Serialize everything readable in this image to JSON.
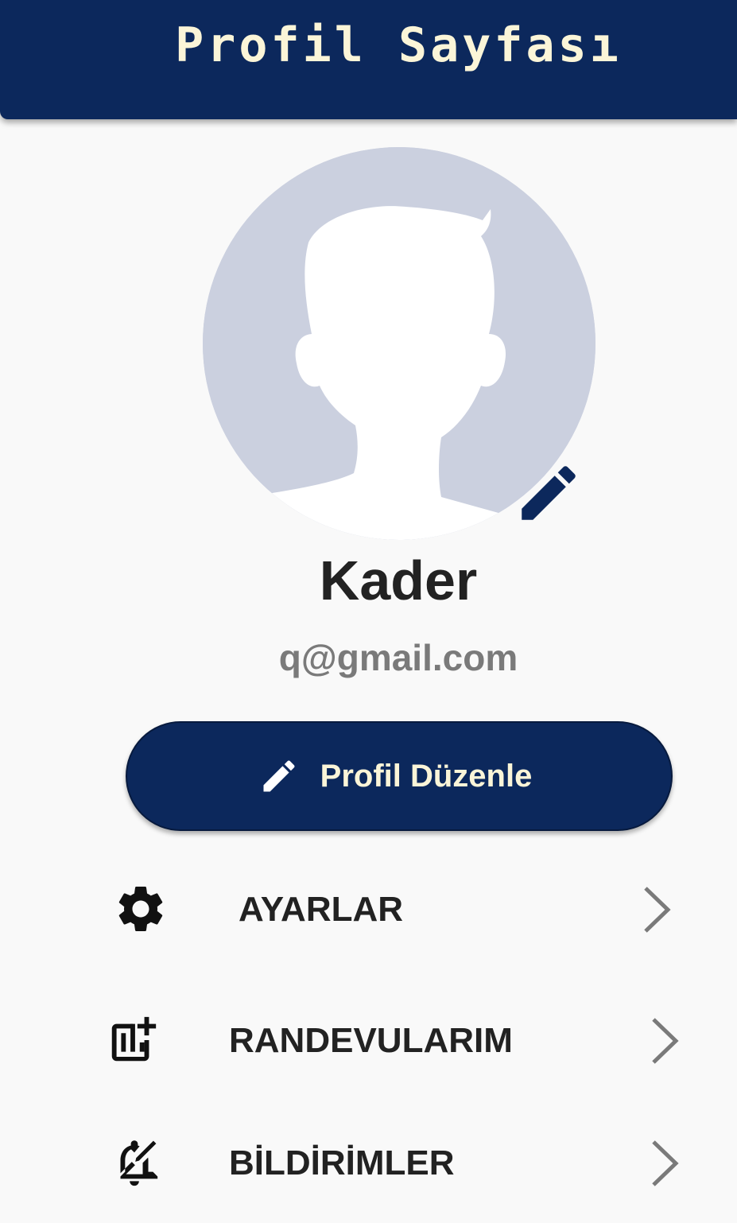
{
  "header": {
    "title": "Profil Sayfası"
  },
  "profile": {
    "name": "Kader",
    "email": "q@gmail.com",
    "avatar_icon": "default-user-avatar",
    "avatar_edit_icon": "pencil-icon"
  },
  "actions": {
    "edit_profile_label": "Profil Düzenle",
    "edit_profile_icon": "pencil-icon"
  },
  "menu": {
    "items": [
      {
        "label": "AYARLAR",
        "icon": "gear-icon"
      },
      {
        "label": "RANDEVULARIM",
        "icon": "chart-add-icon"
      },
      {
        "label": "BİLDİRİMLER",
        "icon": "bell-edit-icon"
      }
    ]
  },
  "colors": {
    "primary": "#0c285c",
    "accent_text": "#fbf5d8",
    "background": "#f9f9f9",
    "avatar_bg": "#cbd0df",
    "email_text": "#7a7a7a",
    "chevron": "#7a7a7a"
  }
}
